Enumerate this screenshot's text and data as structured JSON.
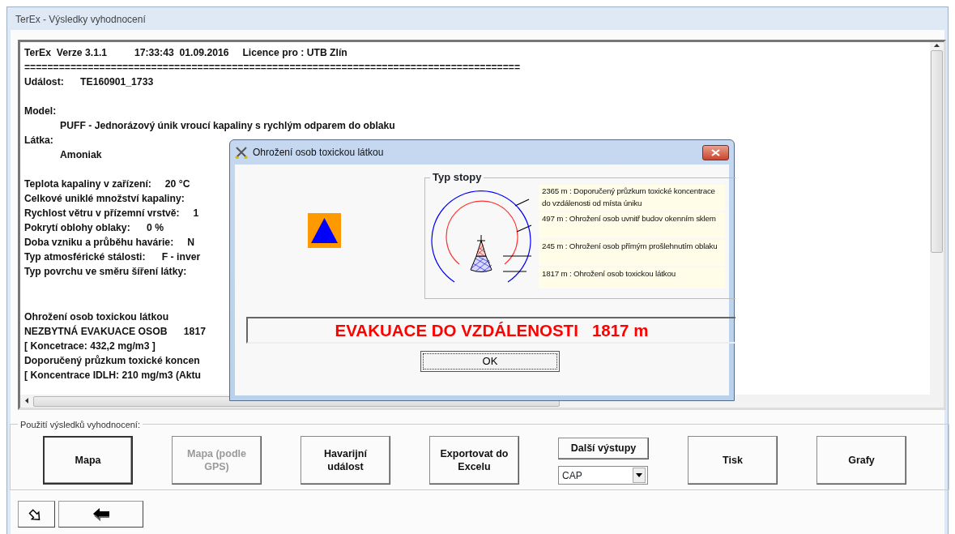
{
  "window": {
    "title": "TerEx - Výsledky vyhodnocení"
  },
  "report": {
    "sections": [
      [
        {
          "text": "TerEx  Verze 3.1.1          17:33:43  01.09.2016     Licence pro : UTB Zlín"
        },
        {
          "text": "======================================================================================"
        },
        {
          "text": "Událost:      TE160901_1733"
        }
      ],
      [
        {
          "label": "Model:",
          "value": "PUFF - Jednorázový únik vroucí kapaliny s rychlým odparem do oblaku"
        },
        {
          "label": "Látka:",
          "value": "Amoniak"
        }
      ],
      [
        {
          "text": "Teplota kapaliny v zařízení:     20 °C"
        },
        {
          "text": "Celkové uniklé množství kapaliny:"
        },
        {
          "text": "Rychlost větru v přízemní vrstvě:     1"
        },
        {
          "text": "Pokrytí oblohy oblaky:      0 %"
        },
        {
          "text": "Doba vzniku a průběhu havárie:     N"
        },
        {
          "text": "Typ atmosférické stálosti:      F - inver"
        },
        {
          "text": "Typ povrchu ve směru šíření látky:"
        }
      ],
      [
        {
          "text": "Ohrožení osob toxickou látkou"
        },
        {
          "text": "NEZBYTNÁ EVAKUACE OSOB      1817"
        },
        {
          "text": "[ Koncetrace: 432,2 mg/m3 ]"
        },
        {
          "text": "Doporučený průzkum toxické koncen"
        },
        {
          "text": "[ Koncentrace IDLH: 210 mg/m3 (Aktu"
        }
      ]
    ]
  },
  "dialog": {
    "title": "Ohrožení osob toxickou látkou",
    "legend_title": "Typ stopy",
    "legend": [
      {
        "text": "2365 m : Doporučený průzkum toxické koncentrace do vzdálenosti od místa úniku"
      },
      {
        "text": "497 m : Ohrožení osob uvnitř budov okenním sklem"
      },
      {
        "text": "245 m : Ohrožení osob přímým prošlehnutím oblaku"
      },
      {
        "text": "1817 m : Ohrožení osob toxickou látkou"
      }
    ],
    "message": "EVAKUACE DO VZDÁLENOSTI   1817 m",
    "ok": "OK"
  },
  "actions": {
    "group_label": "Použití výsledků vyhodnocení:",
    "buttons": [
      {
        "kind": "button",
        "label": "Mapa",
        "disabled": false,
        "default": true
      },
      {
        "kind": "button",
        "label": "Mapa (podle GPS)",
        "disabled": true,
        "default": false
      },
      {
        "kind": "button",
        "label": "Havarijní událost",
        "disabled": false,
        "default": false
      },
      {
        "kind": "button",
        "label": "Exportovat do Excelu",
        "disabled": false,
        "default": false
      },
      {
        "kind": "menu",
        "label": "Další výstupy",
        "value": "CAP",
        "disabled": false,
        "default": false
      },
      {
        "kind": "button",
        "label": "Tisk",
        "disabled": false,
        "default": false
      },
      {
        "kind": "button",
        "label": "Grafy",
        "disabled": false,
        "default": false
      }
    ]
  }
}
